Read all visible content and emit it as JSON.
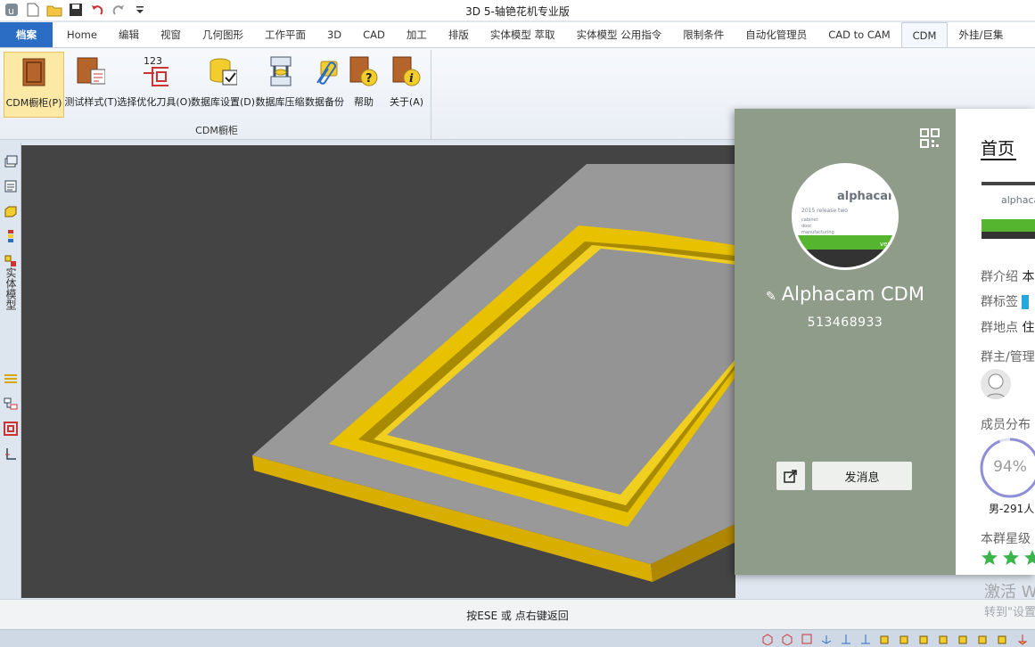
{
  "window": {
    "title": "3D 5-轴铯花机专业版"
  },
  "tabs": [
    {
      "label": "档案"
    },
    {
      "label": "Home"
    },
    {
      "label": "编辑"
    },
    {
      "label": "视窗"
    },
    {
      "label": "几何图形"
    },
    {
      "label": "工作平面"
    },
    {
      "label": "3D"
    },
    {
      "label": "CAD"
    },
    {
      "label": "加工"
    },
    {
      "label": "排版"
    },
    {
      "label": "实体模型 萃取"
    },
    {
      "label": "实体模型 公用指令"
    },
    {
      "label": "限制条件"
    },
    {
      "label": "自动化管理员"
    },
    {
      "label": "CAD to CAM"
    },
    {
      "label": "CDM"
    },
    {
      "label": "外挂/巨集"
    }
  ],
  "ribbon": {
    "buttons": [
      {
        "label": "CDM橱柜(P)",
        "icon": "door-icon"
      },
      {
        "label": "测试样式(T)",
        "icon": "door-report-icon"
      },
      {
        "label": "选择优化刀具(O)",
        "icon": "tool-path-icon",
        "badge": "123"
      },
      {
        "label": "数据库设置(D)",
        "icon": "database-check-icon"
      },
      {
        "label": "数据库压缩",
        "icon": "database-compress-icon"
      },
      {
        "label": "数据备份",
        "icon": "paperclip-icon"
      },
      {
        "label": "帮助",
        "icon": "help-icon"
      },
      {
        "label": "关于(A)",
        "icon": "info-icon"
      }
    ],
    "group_label": "CDM橱柜"
  },
  "left_toolbar": {
    "vertical_label": "实体模型"
  },
  "status": {
    "text": "按ESE 或 点右键返回"
  },
  "group_card": {
    "name": "Alphacam CDM",
    "id": "513468933",
    "message_button": "发消息",
    "home_tab": "首页",
    "avatar_text": "alphacam",
    "avatar_subtext": "2015 release two",
    "avatar_lines": [
      "cabinet",
      "door",
      "manufacturing"
    ],
    "avatar_badge": "vers",
    "thumb_text": "alphacam",
    "info_labels": [
      "群介绍",
      "群标签",
      "群地点"
    ],
    "info_values": [
      "本",
      "",
      "住"
    ],
    "admin_label": "群主/管理",
    "members_label": "成员分布",
    "male_percent": "94%",
    "male_percent_value": 0.94,
    "male_count": "男-291人",
    "rating_label": "本群星级",
    "stars": 3
  },
  "watermark": {
    "line1": "激活 W",
    "line2": "转到\"设置"
  },
  "colors": {
    "accent": "#2b6cc4",
    "card_left": "#8f9c8a",
    "frame": "#e8c100",
    "panel": "#999999",
    "viewport_bg": "#444444",
    "star": "#3bb44a"
  }
}
